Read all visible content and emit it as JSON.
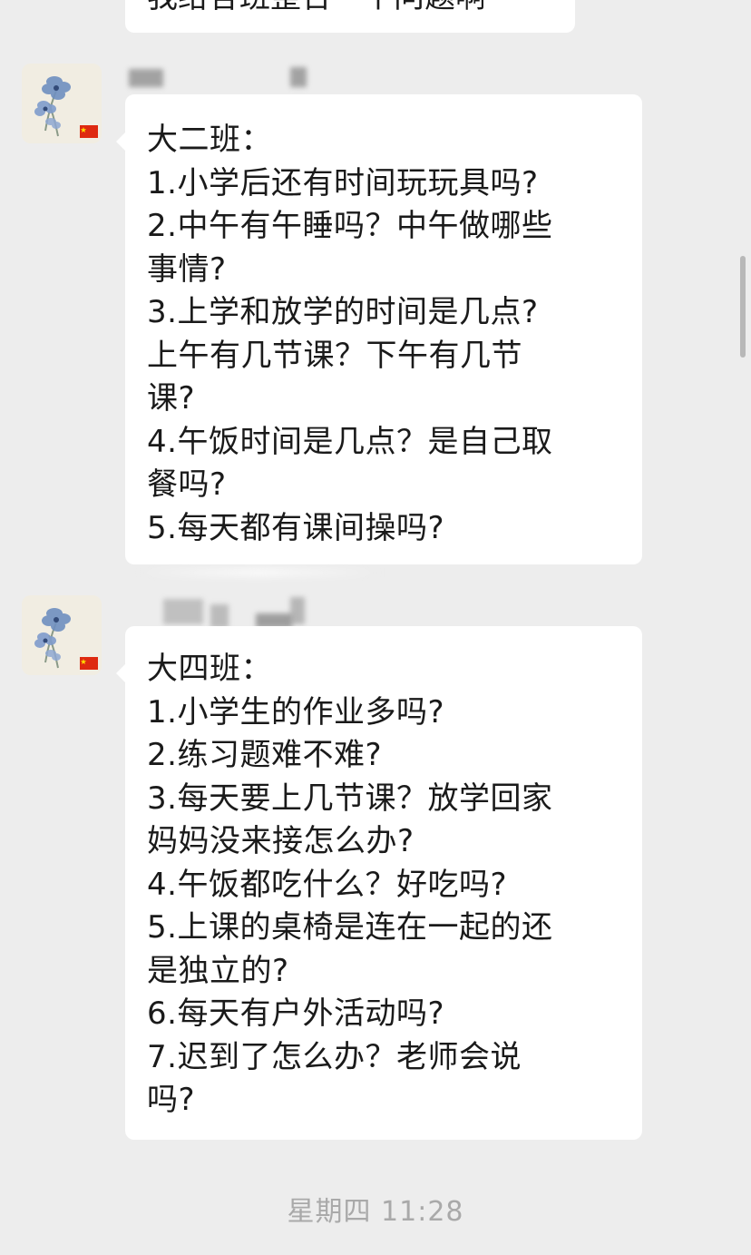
{
  "chat": {
    "previous_message": {
      "text": "我给各班整合一个问题啊"
    },
    "messages": [
      {
        "lines": [
          "大二班：",
          "1.小学后还有时间玩玩具吗?",
          "2.中午有午睡吗？中午做哪些",
          "事情?",
          "3.上学和放学的时间是几点?",
          "上午有几节课？下午有几节",
          "课?",
          "4.午饭时间是几点？是自己取",
          "餐吗?",
          "5.每天都有课间操吗?"
        ]
      },
      {
        "lines": [
          "大四班：",
          "1.小学生的作业多吗?",
          "2.练习题难不难?",
          "3.每天要上几节课？放学回家",
          "妈妈没来接怎么办?",
          "4.午饭都吃什么？好吃吗?",
          "5.上课的桌椅是连在一起的还",
          "是独立的?",
          "6.每天有户外活动吗?",
          "7.迟到了怎么办？老师会说",
          "吗?"
        ]
      }
    ],
    "timestamp": "星期四 11:28"
  },
  "icons": {
    "avatar": "blue-flower-avatar-icon",
    "badge": "china-flag-badge-icon"
  },
  "colors": {
    "background": "#ededed",
    "bubble": "#ffffff",
    "text": "#1a1a1a",
    "timestamp": "#a9a9a9"
  }
}
